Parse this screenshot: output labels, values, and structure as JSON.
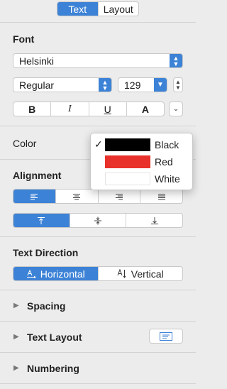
{
  "tabs": [
    {
      "label": "Text",
      "active": true
    },
    {
      "label": "Layout",
      "active": false
    }
  ],
  "font": {
    "section_title": "Font",
    "family": "Helsinki",
    "style": "Regular",
    "size": "129",
    "format_buttons": [
      "B",
      "I",
      "U",
      "A"
    ]
  },
  "color": {
    "section_title": "Color",
    "menu": [
      {
        "label": "Black",
        "color": "#000000",
        "checked": true
      },
      {
        "label": "Red",
        "color": "#e8312a",
        "checked": false
      },
      {
        "label": "White",
        "color": "#ffffff",
        "checked": false
      }
    ]
  },
  "alignment": {
    "section_title": "Alignment",
    "horizontal_icons": [
      "align-left-icon",
      "align-center-icon",
      "align-right-icon",
      "align-justify-icon"
    ],
    "vertical_icons": [
      "align-top-icon",
      "align-middle-icon",
      "align-bottom-icon"
    ]
  },
  "text_direction": {
    "section_title": "Text Direction",
    "horizontal_label": "Horizontal",
    "vertical_label": "Vertical"
  },
  "expanders": {
    "spacing": "Spacing",
    "text_layout": "Text Layout",
    "numbering": "Numbering"
  },
  "accent_color": "#3c82d6"
}
